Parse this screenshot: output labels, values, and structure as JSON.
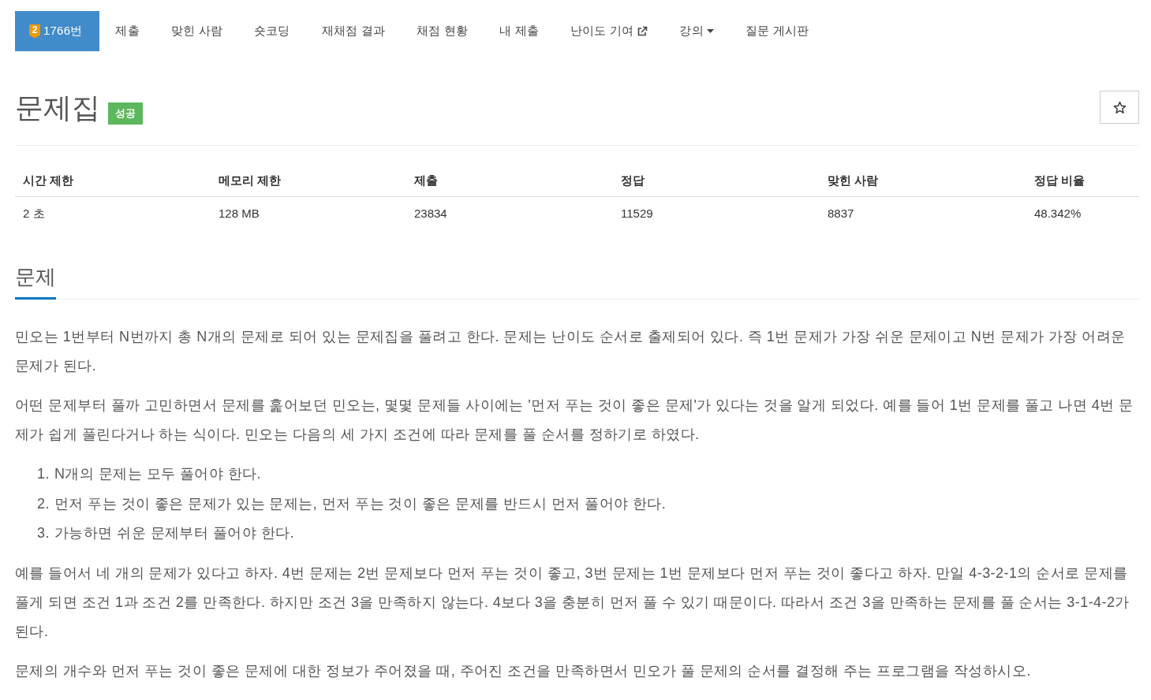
{
  "nav": {
    "items": [
      {
        "label": "1766번",
        "selected": true,
        "tier": "2"
      },
      {
        "label": "제출",
        "selected": false
      },
      {
        "label": "맞힌 사람",
        "selected": false
      },
      {
        "label": "숏코딩",
        "selected": false
      },
      {
        "label": "재채점 결과",
        "selected": false
      },
      {
        "label": "채점 현황",
        "selected": false
      },
      {
        "label": "내 제출",
        "selected": false
      },
      {
        "label": "난이도 기여",
        "selected": false,
        "kind": "external"
      },
      {
        "label": "강의",
        "selected": false,
        "kind": "dropdown"
      },
      {
        "label": "질문 게시판",
        "selected": false
      }
    ]
  },
  "title": {
    "text": "문제집",
    "label": "성공",
    "starred": false
  },
  "stats": {
    "columns": [
      "시간 제한",
      "메모리 제한",
      "제출",
      "정답",
      "맞힌 사람",
      "정답 비율"
    ],
    "rows": [
      [
        "2 초",
        "128 MB",
        "23834",
        "11529",
        "8837",
        "48.342%"
      ]
    ]
  },
  "section": {
    "heading": "문제",
    "body": [
      {
        "kind": "paragraph",
        "text": "민오는 1번부터 N번까지 총 N개의 문제로 되어 있는 문제집을 풀려고 한다. 문제는 난이도 순서로 출제되어 있다. 즉 1번 문제가 가장 쉬운 문제이고 N번 문제가 가장 어려운 문제가 된다."
      },
      {
        "kind": "paragraph",
        "text": "어떤 문제부터 풀까 고민하면서 문제를 훑어보던 민오는, 몇몇 문제들 사이에는 '먼저 푸는 것이 좋은 문제'가 있다는 것을 알게 되었다. 예를 들어 1번 문제를 풀고 나면 4번 문제가 쉽게 풀린다거나 하는 식이다. 민오는 다음의 세 가지 조건에 따라 문제를 풀 순서를 정하기로 하였다."
      },
      {
        "kind": "list",
        "items": [
          {
            "marker": "1.",
            "text": "N개의 문제는 모두 풀어야 한다."
          },
          {
            "marker": "2.",
            "text": "먼저 푸는 것이 좋은 문제가 있는 문제는, 먼저 푸는 것이 좋은 문제를 반드시 먼저 풀어야 한다."
          },
          {
            "marker": "3.",
            "text": "가능하면 쉬운 문제부터 풀어야 한다."
          }
        ]
      },
      {
        "kind": "paragraph",
        "text": "예를 들어서 네 개의 문제가 있다고 하자. 4번 문제는 2번 문제보다 먼저 푸는 것이 좋고, 3번 문제는 1번 문제보다 먼저 푸는 것이 좋다고 하자. 만일 4-3-2-1의 순서로 문제를 풀게 되면 조건 1과 조건 2를 만족한다. 하지만 조건 3을 만족하지 않는다. 4보다 3을 충분히 먼저 풀 수 있기 때문이다. 따라서 조건 3을 만족하는 문제를 풀 순서는 3-1-4-2가 된다."
      },
      {
        "kind": "paragraph",
        "text": "문제의 개수와 먼저 푸는 것이 좋은 문제에 대한 정보가 주어졌을 때, 주어진 조건을 만족하면서 민오가 풀 문제의 순서를 결정해 주는 프로그램을 작성하시오."
      }
    ]
  }
}
